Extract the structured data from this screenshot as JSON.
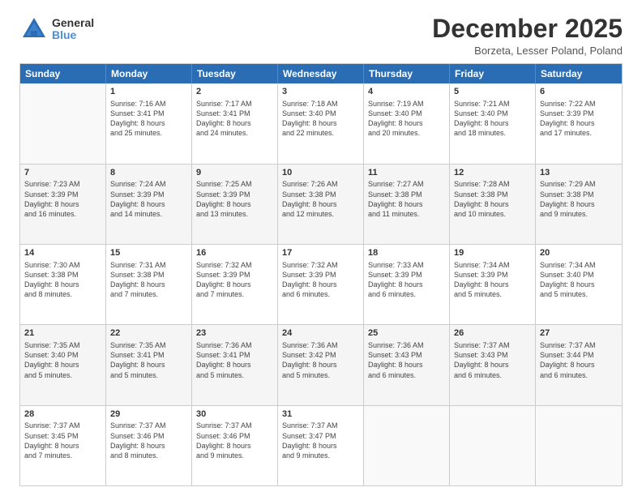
{
  "header": {
    "logo_general": "General",
    "logo_blue": "Blue",
    "title": "December 2025",
    "subtitle": "Borzeta, Lesser Poland, Poland"
  },
  "days_of_week": [
    "Sunday",
    "Monday",
    "Tuesday",
    "Wednesday",
    "Thursday",
    "Friday",
    "Saturday"
  ],
  "weeks": [
    [
      {
        "day": "",
        "info": ""
      },
      {
        "day": "1",
        "info": "Sunrise: 7:16 AM\nSunset: 3:41 PM\nDaylight: 8 hours\nand 25 minutes."
      },
      {
        "day": "2",
        "info": "Sunrise: 7:17 AM\nSunset: 3:41 PM\nDaylight: 8 hours\nand 24 minutes."
      },
      {
        "day": "3",
        "info": "Sunrise: 7:18 AM\nSunset: 3:40 PM\nDaylight: 8 hours\nand 22 minutes."
      },
      {
        "day": "4",
        "info": "Sunrise: 7:19 AM\nSunset: 3:40 PM\nDaylight: 8 hours\nand 20 minutes."
      },
      {
        "day": "5",
        "info": "Sunrise: 7:21 AM\nSunset: 3:40 PM\nDaylight: 8 hours\nand 18 minutes."
      },
      {
        "day": "6",
        "info": "Sunrise: 7:22 AM\nSunset: 3:39 PM\nDaylight: 8 hours\nand 17 minutes."
      }
    ],
    [
      {
        "day": "7",
        "info": "Sunrise: 7:23 AM\nSunset: 3:39 PM\nDaylight: 8 hours\nand 16 minutes."
      },
      {
        "day": "8",
        "info": "Sunrise: 7:24 AM\nSunset: 3:39 PM\nDaylight: 8 hours\nand 14 minutes."
      },
      {
        "day": "9",
        "info": "Sunrise: 7:25 AM\nSunset: 3:39 PM\nDaylight: 8 hours\nand 13 minutes."
      },
      {
        "day": "10",
        "info": "Sunrise: 7:26 AM\nSunset: 3:38 PM\nDaylight: 8 hours\nand 12 minutes."
      },
      {
        "day": "11",
        "info": "Sunrise: 7:27 AM\nSunset: 3:38 PM\nDaylight: 8 hours\nand 11 minutes."
      },
      {
        "day": "12",
        "info": "Sunrise: 7:28 AM\nSunset: 3:38 PM\nDaylight: 8 hours\nand 10 minutes."
      },
      {
        "day": "13",
        "info": "Sunrise: 7:29 AM\nSunset: 3:38 PM\nDaylight: 8 hours\nand 9 minutes."
      }
    ],
    [
      {
        "day": "14",
        "info": "Sunrise: 7:30 AM\nSunset: 3:38 PM\nDaylight: 8 hours\nand 8 minutes."
      },
      {
        "day": "15",
        "info": "Sunrise: 7:31 AM\nSunset: 3:38 PM\nDaylight: 8 hours\nand 7 minutes."
      },
      {
        "day": "16",
        "info": "Sunrise: 7:32 AM\nSunset: 3:39 PM\nDaylight: 8 hours\nand 7 minutes."
      },
      {
        "day": "17",
        "info": "Sunrise: 7:32 AM\nSunset: 3:39 PM\nDaylight: 8 hours\nand 6 minutes."
      },
      {
        "day": "18",
        "info": "Sunrise: 7:33 AM\nSunset: 3:39 PM\nDaylight: 8 hours\nand 6 minutes."
      },
      {
        "day": "19",
        "info": "Sunrise: 7:34 AM\nSunset: 3:39 PM\nDaylight: 8 hours\nand 5 minutes."
      },
      {
        "day": "20",
        "info": "Sunrise: 7:34 AM\nSunset: 3:40 PM\nDaylight: 8 hours\nand 5 minutes."
      }
    ],
    [
      {
        "day": "21",
        "info": "Sunrise: 7:35 AM\nSunset: 3:40 PM\nDaylight: 8 hours\nand 5 minutes."
      },
      {
        "day": "22",
        "info": "Sunrise: 7:35 AM\nSunset: 3:41 PM\nDaylight: 8 hours\nand 5 minutes."
      },
      {
        "day": "23",
        "info": "Sunrise: 7:36 AM\nSunset: 3:41 PM\nDaylight: 8 hours\nand 5 minutes."
      },
      {
        "day": "24",
        "info": "Sunrise: 7:36 AM\nSunset: 3:42 PM\nDaylight: 8 hours\nand 5 minutes."
      },
      {
        "day": "25",
        "info": "Sunrise: 7:36 AM\nSunset: 3:43 PM\nDaylight: 8 hours\nand 6 minutes."
      },
      {
        "day": "26",
        "info": "Sunrise: 7:37 AM\nSunset: 3:43 PM\nDaylight: 8 hours\nand 6 minutes."
      },
      {
        "day": "27",
        "info": "Sunrise: 7:37 AM\nSunset: 3:44 PM\nDaylight: 8 hours\nand 6 minutes."
      }
    ],
    [
      {
        "day": "28",
        "info": "Sunrise: 7:37 AM\nSunset: 3:45 PM\nDaylight: 8 hours\nand 7 minutes."
      },
      {
        "day": "29",
        "info": "Sunrise: 7:37 AM\nSunset: 3:46 PM\nDaylight: 8 hours\nand 8 minutes."
      },
      {
        "day": "30",
        "info": "Sunrise: 7:37 AM\nSunset: 3:46 PM\nDaylight: 8 hours\nand 9 minutes."
      },
      {
        "day": "31",
        "info": "Sunrise: 7:37 AM\nSunset: 3:47 PM\nDaylight: 8 hours\nand 9 minutes."
      },
      {
        "day": "",
        "info": ""
      },
      {
        "day": "",
        "info": ""
      },
      {
        "day": "",
        "info": ""
      }
    ]
  ]
}
